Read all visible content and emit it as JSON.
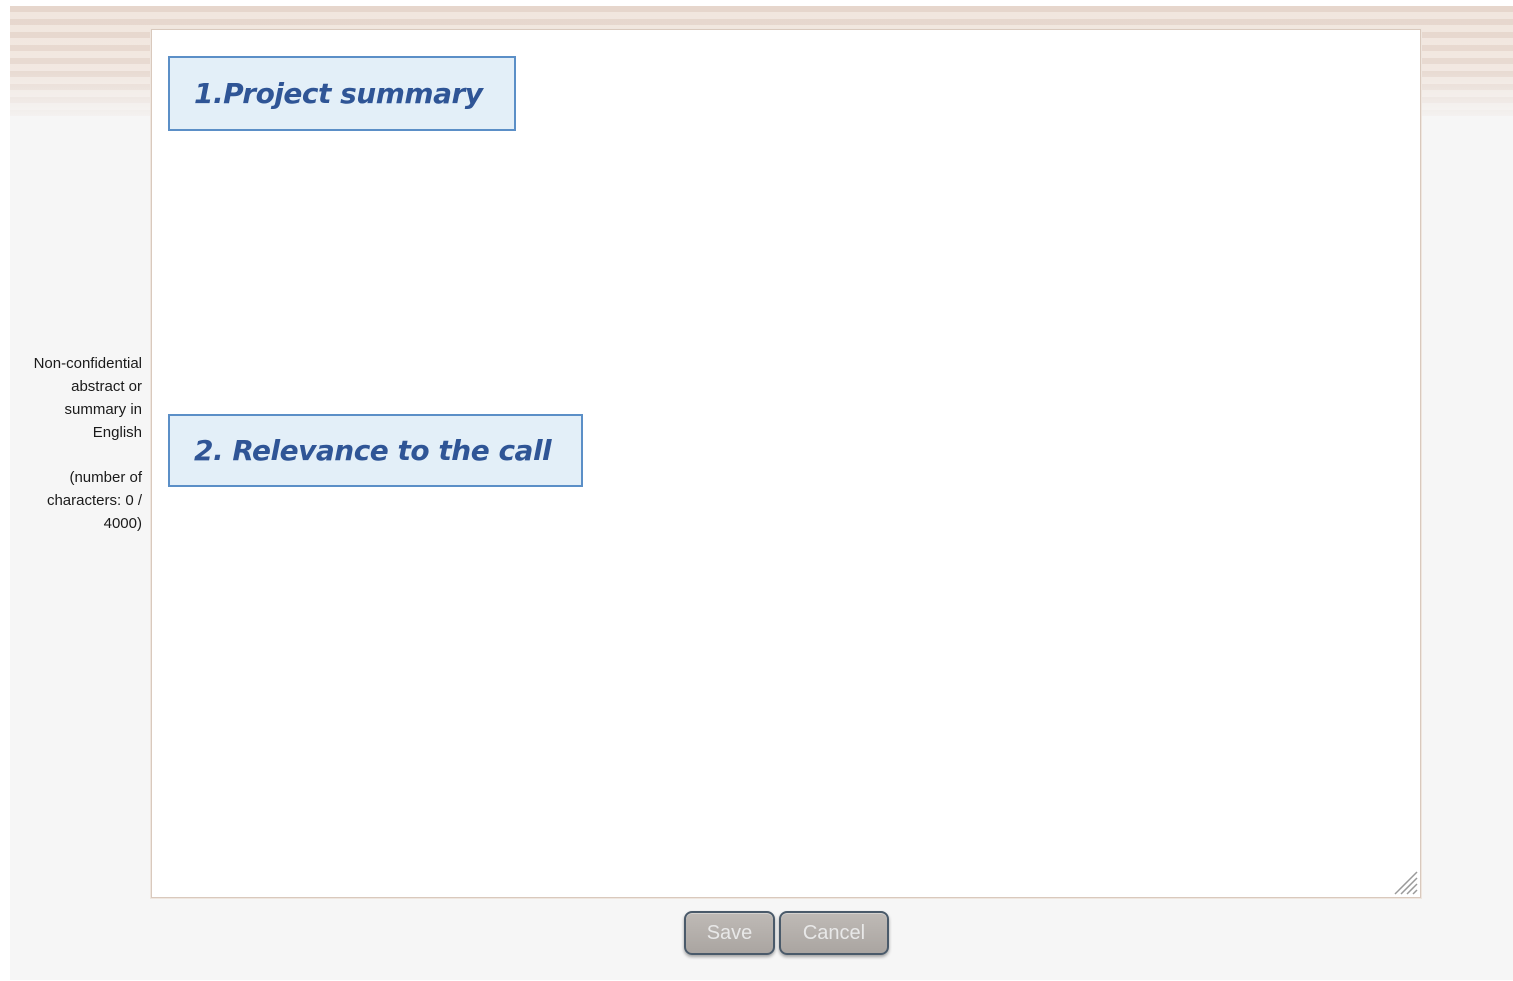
{
  "form": {
    "field_label": "Non-confidential abstract or summary in English",
    "char_count_label": "(number of characters: 0 / 4000)",
    "textarea_value": ""
  },
  "annotations": [
    {
      "label": "1.Project summary"
    },
    {
      "label": "2. Relevance to the call"
    }
  ],
  "actions": {
    "save_label": "Save",
    "cancel_label": "Cancel"
  },
  "colors": {
    "annotation_border": "#5b8fc7",
    "annotation_fill": "#e3eff8",
    "annotation_text": "#2f5596",
    "button_fill": "#aaa5a1"
  },
  "icons": {
    "resize_handle": "resize-grip-icon"
  }
}
